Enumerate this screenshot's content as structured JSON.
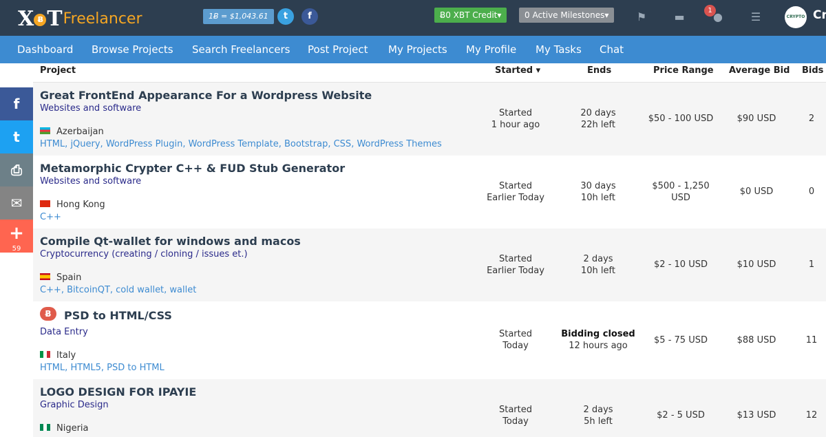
{
  "header": {
    "logo_xot": "XOT",
    "logo_freelancer": "Freelancer",
    "rate": "1Ƀ = $1,043.61",
    "credit": "Ƀ0  XBT Credit▾",
    "milestones": "0  Active Milestones▾",
    "notifications_count": "1",
    "avatar_text": "CRYPTO",
    "username": "Cr",
    "icons": [
      "twitter-icon",
      "facebook-icon",
      "flag-icon",
      "chat-bubble-icon",
      "alert-icon",
      "list-icon"
    ]
  },
  "nav": {
    "items": [
      "Dashboard",
      "Browse Projects",
      "Search Freelancers",
      "Post Project",
      "My Projects",
      "My Profile",
      "My Tasks",
      "Chat"
    ]
  },
  "share": {
    "count": "59",
    "icons": [
      "facebook-icon",
      "twitter-icon",
      "print-icon",
      "email-icon",
      "plus-icon"
    ]
  },
  "table": {
    "headers": {
      "project": "Project",
      "started": "Started ▾",
      "ends": "Ends",
      "price": "Price Range",
      "avg": "Average Bid",
      "bids": "Bids"
    },
    "rows": [
      {
        "title": "Great FrontEnd Appearance For a Wordpress Website",
        "category": "Websites and software",
        "country": "Azerbaijan",
        "tags": "HTML, jQuery, WordPress Plugin, WordPress Template, Bootstrap, CSS, WordPress Themes",
        "started_1": "Started",
        "started_2": "1 hour ago",
        "ends_1": "20 days",
        "ends_2": "22h left",
        "price_1": "$50 - 100 USD",
        "price_2": "",
        "avg": "$90 USD",
        "bids": "2"
      },
      {
        "title": "Metamorphic Crypter C++ & FUD Stub Generator",
        "category": "Websites and software",
        "country": "Hong Kong",
        "tags": "C++",
        "started_1": "Started",
        "started_2": "Earlier Today",
        "ends_1": "30 days",
        "ends_2": "10h left",
        "price_1": "$500 - 1,250",
        "price_2": "USD",
        "avg": "$0 USD",
        "bids": "0"
      },
      {
        "title": "Compile Qt-wallet for windows and macos",
        "category": "Cryptocurrency (creating / cloning / issues et.)",
        "country": "Spain",
        "tags": "C++, BitcoinQT, cold wallet, wallet",
        "started_1": "Started",
        "started_2": "Earlier Today",
        "ends_1": "2 days",
        "ends_2": "10h left",
        "price_1": "$2 - 10 USD",
        "price_2": "",
        "avg": "$10 USD",
        "bids": "1"
      },
      {
        "title": "PSD to HTML/CSS",
        "category": "Data Entry",
        "country": "Italy",
        "tags": "HTML, HTML5, PSD to HTML",
        "started_1": "Started",
        "started_2": "Today",
        "ends_1": "Bidding closed",
        "ends_2": "12 hours ago",
        "price_1": "$5 - 75 USD",
        "price_2": "",
        "avg": "$88 USD",
        "bids": "11",
        "badge": "Ƀ"
      },
      {
        "title": "LOGO DESIGN FOR IPAYIE",
        "category": "Graphic Design",
        "country": "Nigeria",
        "tags": "",
        "started_1": "Started",
        "started_2": "Today",
        "ends_1": "2 days",
        "ends_2": "5h left",
        "price_1": "$2 - 5 USD",
        "price_2": "",
        "avg": "$13 USD",
        "bids": "12"
      }
    ]
  }
}
